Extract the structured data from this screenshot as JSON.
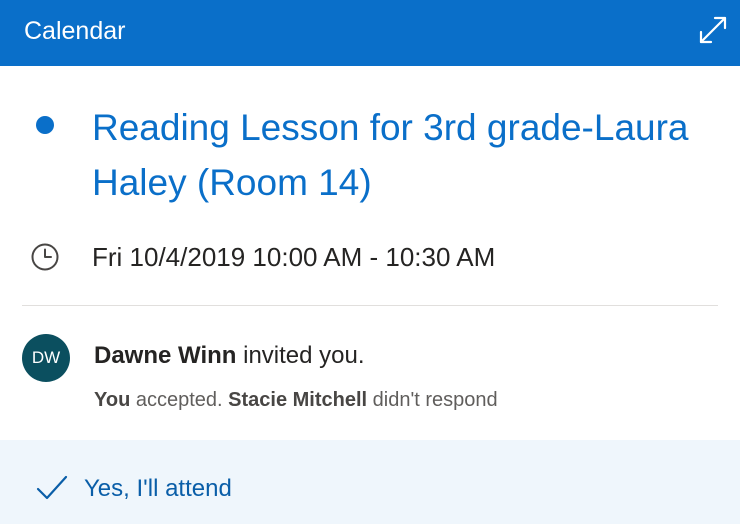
{
  "colors": {
    "header_bg": "#0a6fc9",
    "accent": "#0a6fc9",
    "category_dot": "#0a6fc9",
    "avatar_bg": "#0b4f5f",
    "response_bar_bg": "#eff6fc"
  },
  "header": {
    "title": "Calendar",
    "expand_icon": "expand-icon"
  },
  "event": {
    "title": "Reading Lesson for 3rd grade-Laura Haley (Room 14)",
    "time": "Fri 10/4/2019 10:00 AM - 10:30 AM",
    "time_icon": "clock-icon"
  },
  "invitation": {
    "avatar_initials": "DW",
    "organizer": "Dawne Winn",
    "invited_text": " invited you.",
    "you_label": "You",
    "accepted_text": " accepted. ",
    "other_attendee": "Stacie Mitchell",
    "other_status": " didn't respond"
  },
  "response": {
    "label": "Yes, I'll attend",
    "icon": "checkmark-icon"
  }
}
